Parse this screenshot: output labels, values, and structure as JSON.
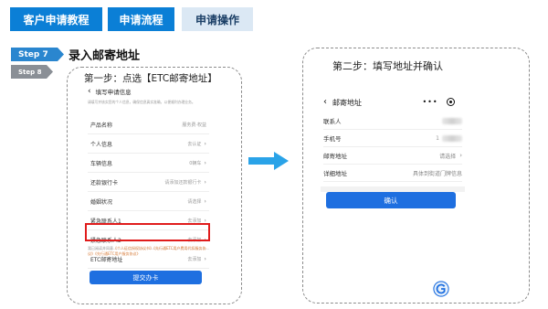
{
  "tabs": {
    "main": "客户申请教程",
    "process": "申请流程",
    "operation": "申请操作"
  },
  "steps": {
    "step7": "Step 7",
    "step8": "Step 8"
  },
  "section_title": "录入邮寄地址",
  "left_panel": {
    "heading": "第一步：点选【ETC邮寄地址】",
    "page_title": "填写申请信息",
    "notice": "请填写并核实您的个人信息，确保信息真实准确，以便顺利办理业务。",
    "rows": [
      {
        "label": "产品名称",
        "value": "服务费·权益"
      },
      {
        "label": "个人信息",
        "value": "去认证"
      },
      {
        "label": "车辆信息",
        "value": "0辆车"
      },
      {
        "label": "还款银行卡",
        "value": "请添加还款银行卡"
      },
      {
        "label": "婚姻状况",
        "value": "请选择"
      },
      {
        "label": "紧急联系人1",
        "value": "去添加"
      },
      {
        "label": "紧急联系人2",
        "value": "去添加"
      },
      {
        "label": "ETC邮寄地址",
        "value": "去添加"
      }
    ],
    "agreement_prefix": "我已阅读并同意",
    "agreement_link_1": "《个人征信授权协议书》",
    "agreement_link_2": "《先行通ETC用户费用代扣服务协议》",
    "agreement_link_3": "《先行通ETC用户服务协议》",
    "submit_label": "提交办卡"
  },
  "right_panel": {
    "heading": "第二步：填写地址并确认",
    "page_title": "邮寄地址",
    "rows": [
      {
        "label": "联系人",
        "value": ""
      },
      {
        "label": "手机号",
        "value": "1"
      },
      {
        "label": "邮寄地址",
        "value": "请选择"
      },
      {
        "label": "详细地址",
        "value": "具体到街道门牌信息"
      }
    ],
    "confirm_label": "确认"
  },
  "icons": {
    "back": "chevron-left-icon",
    "more": "more-dots-icon",
    "close": "target-close-icon",
    "arrow": "right-arrow-icon",
    "logo": "app-logo-icon"
  },
  "colors": {
    "primary": "#0b7fd6",
    "button": "#1e6fe0",
    "highlight": "#e01c1c",
    "arrow": "#2aa3e8"
  }
}
